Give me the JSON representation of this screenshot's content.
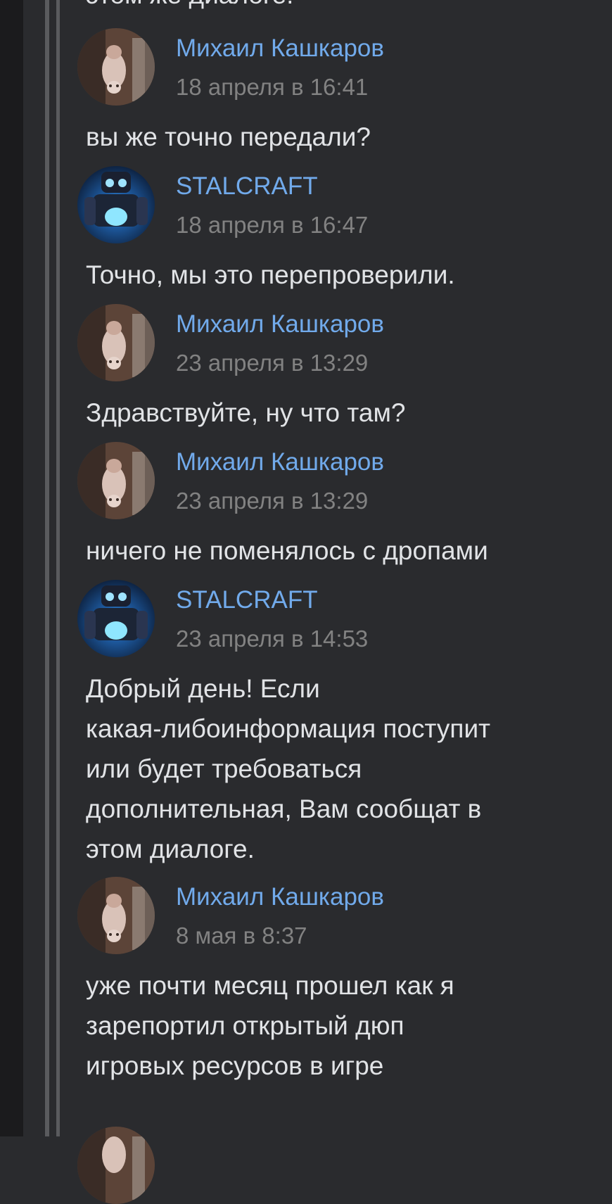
{
  "previous_message_tail": "этом же диалоге.",
  "messages": [
    {
      "author": "Михаил Кашкаров",
      "avatar": "user-avatar",
      "time": "18 апреля в 16:41",
      "text": "вы же точно передали?"
    },
    {
      "author": "STALCRAFT",
      "avatar": "stalcraft-avatar",
      "time": "18 апреля в 16:47",
      "text": "Точно, мы это перепроверили."
    },
    {
      "author": "Михаил Кашкаров",
      "avatar": "user-avatar",
      "time": "23 апреля в 13:29",
      "text": "Здравствуйте, ну что там?"
    },
    {
      "author": "Михаил Кашкаров",
      "avatar": "user-avatar",
      "time": "23 апреля в 13:29",
      "text": "ничего не поменялось с дропами"
    },
    {
      "author": "STALCRAFT",
      "avatar": "stalcraft-avatar",
      "time": "23 апреля в 14:53",
      "text": "Добрый день! Если\nкакая-либоинформация поступит\nили будет требоваться\nдополнительная, Вам сообщат в\nэтом диалоге."
    },
    {
      "author": "Михаил Кашкаров",
      "avatar": "user-avatar",
      "time": "8 мая в 8:37",
      "text": "уже почти месяц прошел как я\nзарепортил открытый дюп\nигровых ресурсов в игре"
    }
  ],
  "colors": {
    "background": "#2a2b2e",
    "author_link": "#71aaeb",
    "timestamp": "#828282",
    "message_text": "#e1e3e6",
    "quote_bar": "#5a5b5e"
  }
}
